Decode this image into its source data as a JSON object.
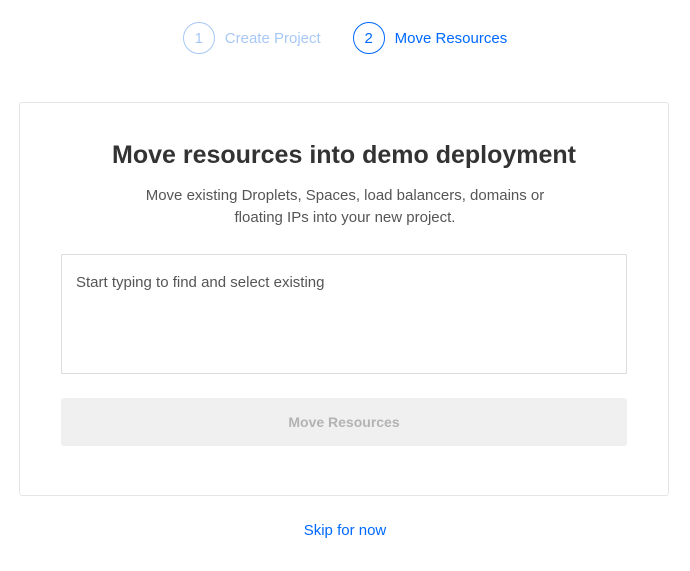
{
  "stepper": {
    "steps": [
      {
        "number": "1",
        "label": "Create Project",
        "state": "done"
      },
      {
        "number": "2",
        "label": "Move Resources",
        "state": "active"
      }
    ]
  },
  "card": {
    "title": "Move resources into demo deployment",
    "subtitle": "Move existing Droplets, Spaces, load balancers, domains or floating IPs into your new project.",
    "search": {
      "placeholder": "Start typing to find and select existing",
      "value": ""
    },
    "move_button_label": "Move Resources",
    "move_button_disabled": true
  },
  "skip_label": "Skip for now",
  "colors": {
    "accent": "#0069ff",
    "accent_light": "#a8c8f5",
    "disabled_bg": "#f0f0f0",
    "disabled_text": "#b3b3b3"
  }
}
